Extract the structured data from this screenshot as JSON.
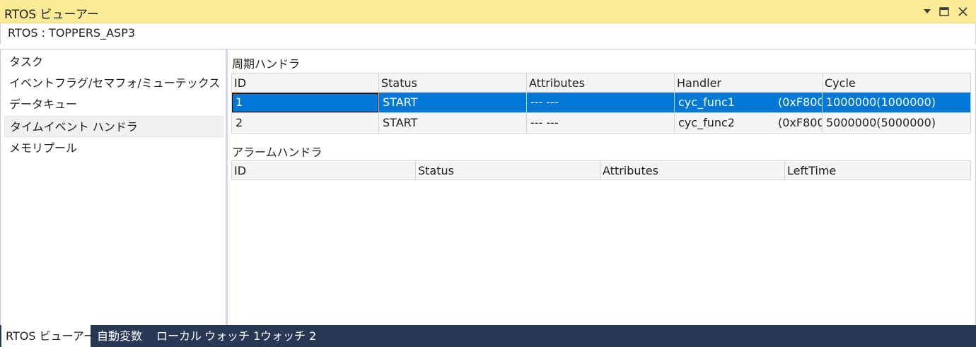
{
  "window": {
    "title": "RTOS ビューアー",
    "controls": {
      "dropdown_icon": "triangle-down-icon",
      "maximize_icon": "maximize-icon",
      "close_icon": "close-icon"
    },
    "colors": {
      "title_bg": "#fbeb94",
      "selection": "#0078d7",
      "tabbar_bg": "#293955"
    }
  },
  "rtos_info": "RTOS : TOPPERS_ASP3",
  "sidebar": {
    "items": [
      {
        "label": "タスク"
      },
      {
        "label": "イベントフラグ/セマフォ/ミューテックス"
      },
      {
        "label": "データキュー"
      },
      {
        "label": "タイムイベント ハンドラ",
        "selected": true
      },
      {
        "label": "メモリプール"
      }
    ]
  },
  "cyclic": {
    "title": "周期ハンドラ",
    "columns": [
      "ID",
      "Status",
      "Attributes",
      "Handler",
      "Cycle"
    ],
    "rows": [
      {
        "id": "1",
        "status": "START",
        "attributes": "--- ---",
        "handler": "cyc_func1",
        "address": "(0xF800",
        "cycle": "1000000(1000000)",
        "selected": true
      },
      {
        "id": "2",
        "status": "START",
        "attributes": "--- ---",
        "handler": "cyc_func2",
        "address": "(0xF800",
        "cycle": "5000000(5000000)"
      }
    ]
  },
  "alarm": {
    "title": "アラームハンドラ",
    "columns": [
      "ID",
      "Status",
      "Attributes",
      "LeftTime"
    ]
  },
  "tabs": [
    {
      "label": "RTOS ビューアー",
      "active": true
    },
    {
      "label": "自動変数"
    },
    {
      "label": "ローカル"
    },
    {
      "label": "ウォッチ 1"
    },
    {
      "label": "ウォッチ 2"
    }
  ]
}
